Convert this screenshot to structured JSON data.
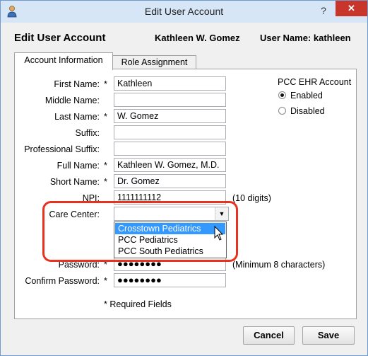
{
  "window": {
    "title": "Edit User Account",
    "help_glyph": "?",
    "close_glyph": "✕"
  },
  "header": {
    "title": "Edit User Account",
    "user_full_name": "Kathleen W. Gomez",
    "user_name_label": "User Name: kathleen"
  },
  "tabs": [
    {
      "label": "Account Information",
      "active": true
    },
    {
      "label": "Role Assignment",
      "active": false
    }
  ],
  "form": {
    "first_name": {
      "label": "First Name:",
      "required": "*",
      "value": "Kathleen"
    },
    "middle_name": {
      "label": "Middle Name:",
      "value": ""
    },
    "last_name": {
      "label": "Last Name:",
      "required": "*",
      "value": "W. Gomez"
    },
    "suffix": {
      "label": "Suffix:",
      "value": ""
    },
    "professional_suffix": {
      "label": "Professional Suffix:",
      "value": ""
    },
    "full_name": {
      "label": "Full Name:",
      "required": "*",
      "value": "Kathleen W. Gomez, M.D."
    },
    "short_name": {
      "label": "Short Name:",
      "required": "*",
      "value": "Dr. Gomez"
    },
    "npi": {
      "label": "NPI:",
      "value": "1111111112",
      "hint": "(10 digits)"
    },
    "care_center": {
      "label": "Care Center:",
      "value": "",
      "options": [
        "Crosstown Pediatrics",
        "PCC Pediatrics",
        "PCC South Pediatrics"
      ],
      "highlighted_option": "Crosstown Pediatrics"
    },
    "password": {
      "label": "Password:",
      "required": "*",
      "value": "●●●●●●●●",
      "hint": "(Minimum 8 characters)"
    },
    "confirm_password": {
      "label": "Confirm Password:",
      "required": "*",
      "value": "●●●●●●●●"
    },
    "required_note": "* Required Fields"
  },
  "pcc_ehr": {
    "title": "PCC EHR Account",
    "options": [
      {
        "label": "Enabled",
        "selected": true
      },
      {
        "label": "Disabled",
        "selected": false
      }
    ]
  },
  "buttons": {
    "cancel": "Cancel",
    "save": "Save"
  },
  "colors": {
    "highlight": "#e8321f",
    "selection": "#3399ff",
    "close": "#c7352b"
  }
}
